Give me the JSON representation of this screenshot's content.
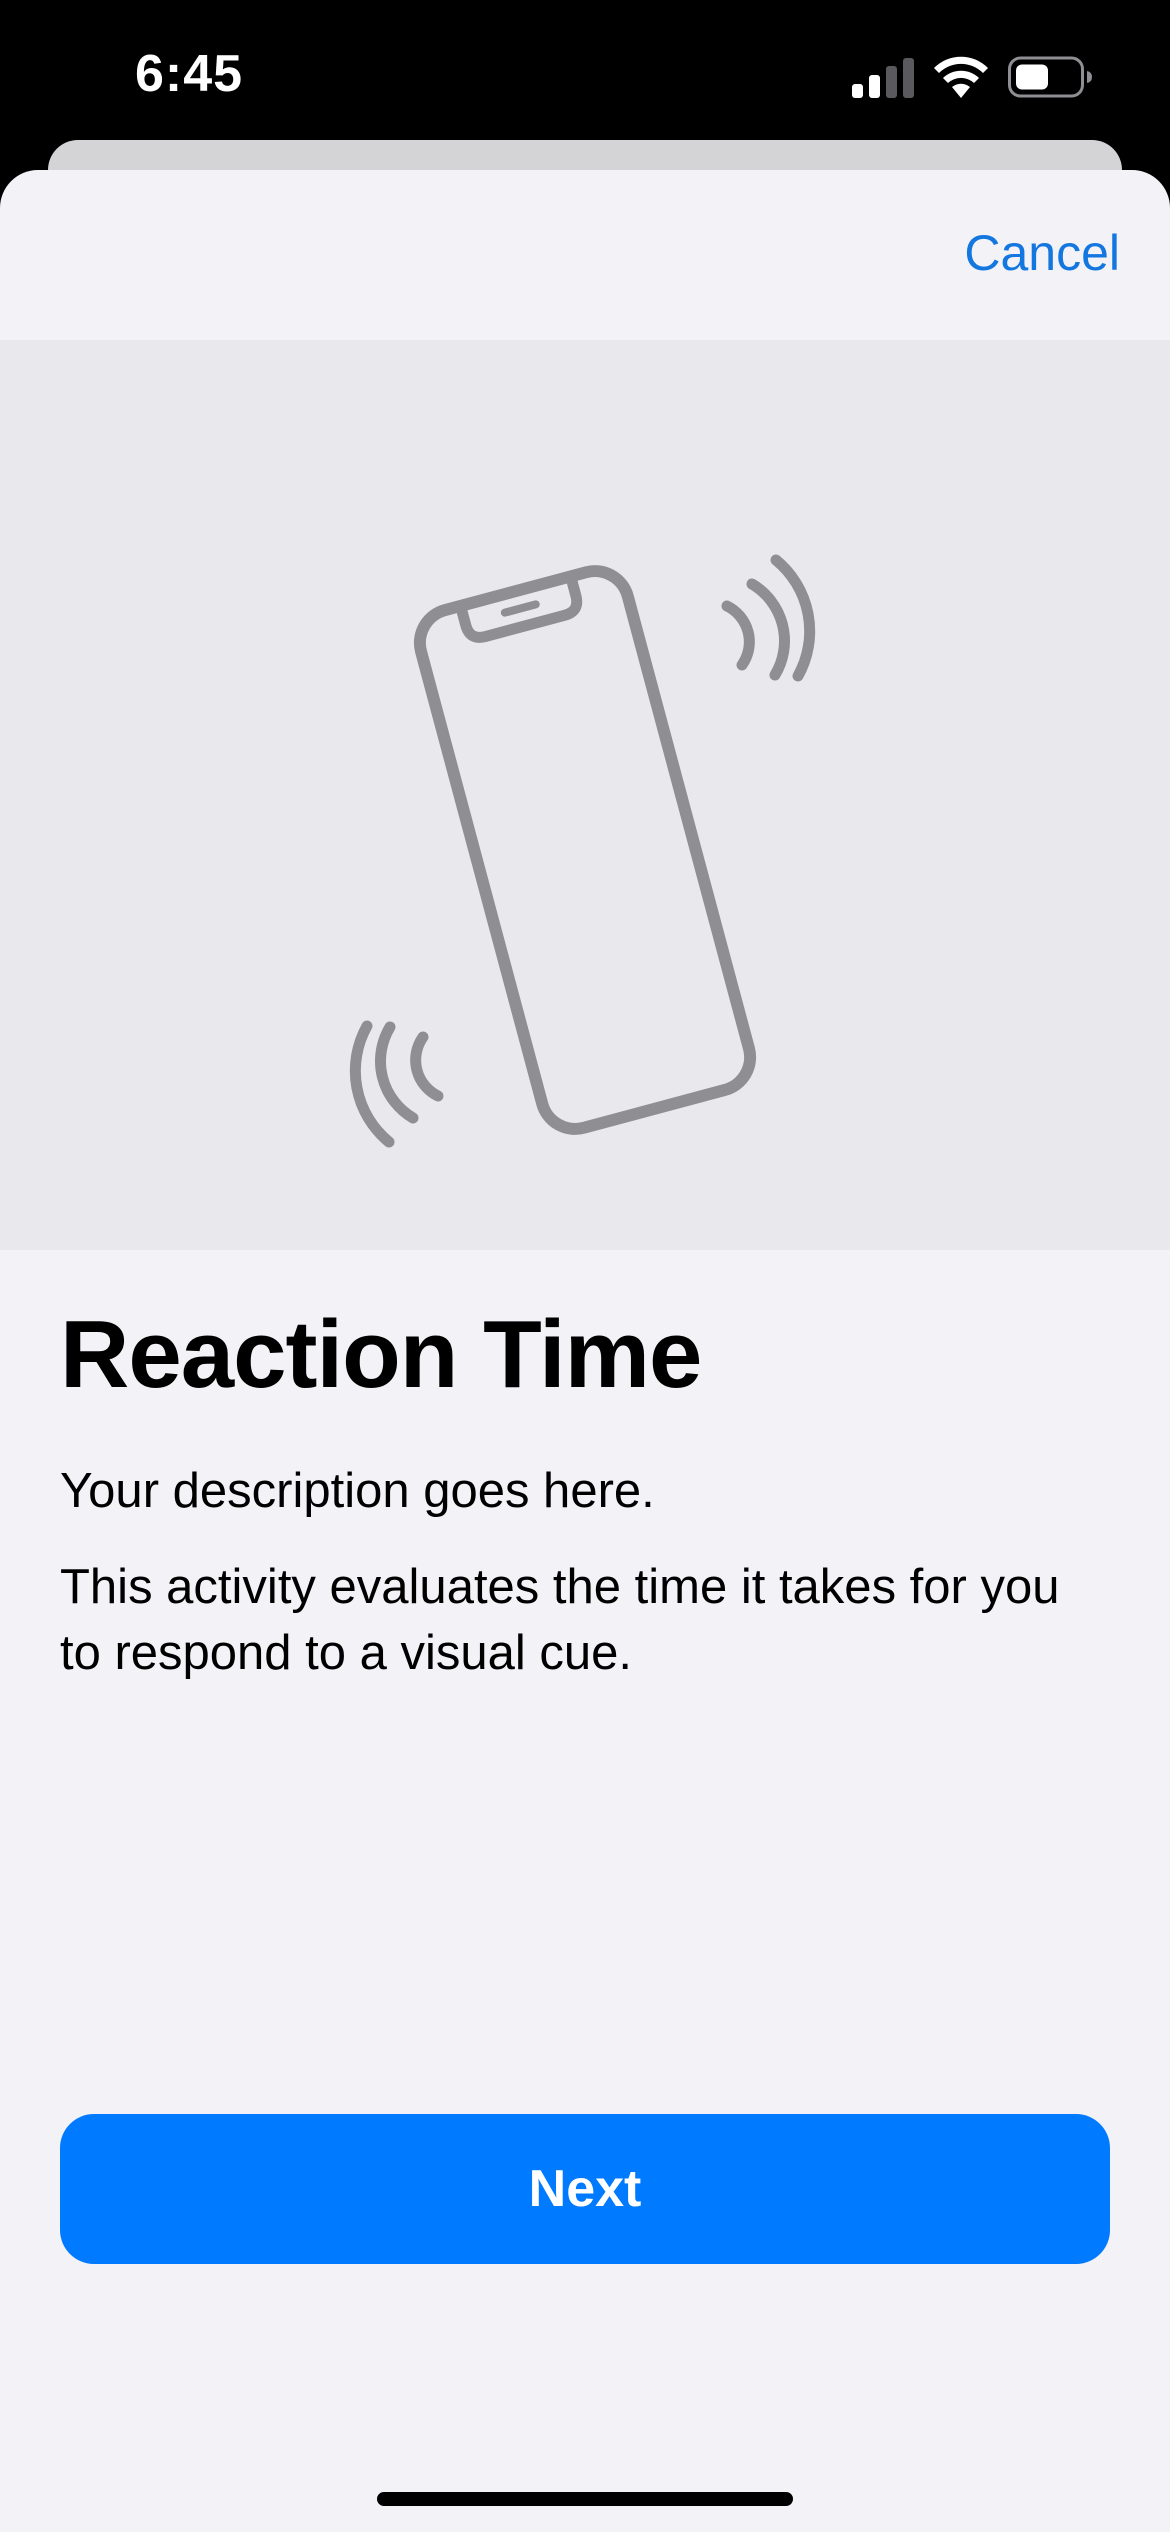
{
  "status_bar": {
    "time": "6:45",
    "signal_icon": "cellular-signal-icon",
    "wifi_icon": "wifi-icon",
    "battery_icon": "battery-icon"
  },
  "nav": {
    "cancel_label": "Cancel"
  },
  "illustration": {
    "icon": "phone-vibrating-icon",
    "color": "#8e8e93"
  },
  "content": {
    "title": "Reaction Time",
    "description": "Your description goes here.",
    "detail": "This activity evaluates the time it takes for you to respond to a visual cue."
  },
  "footer": {
    "next_label": "Next"
  },
  "colors": {
    "accent": "#007aff",
    "background": "#f2f2f7",
    "illustration_bg": "#e8e8ed"
  }
}
